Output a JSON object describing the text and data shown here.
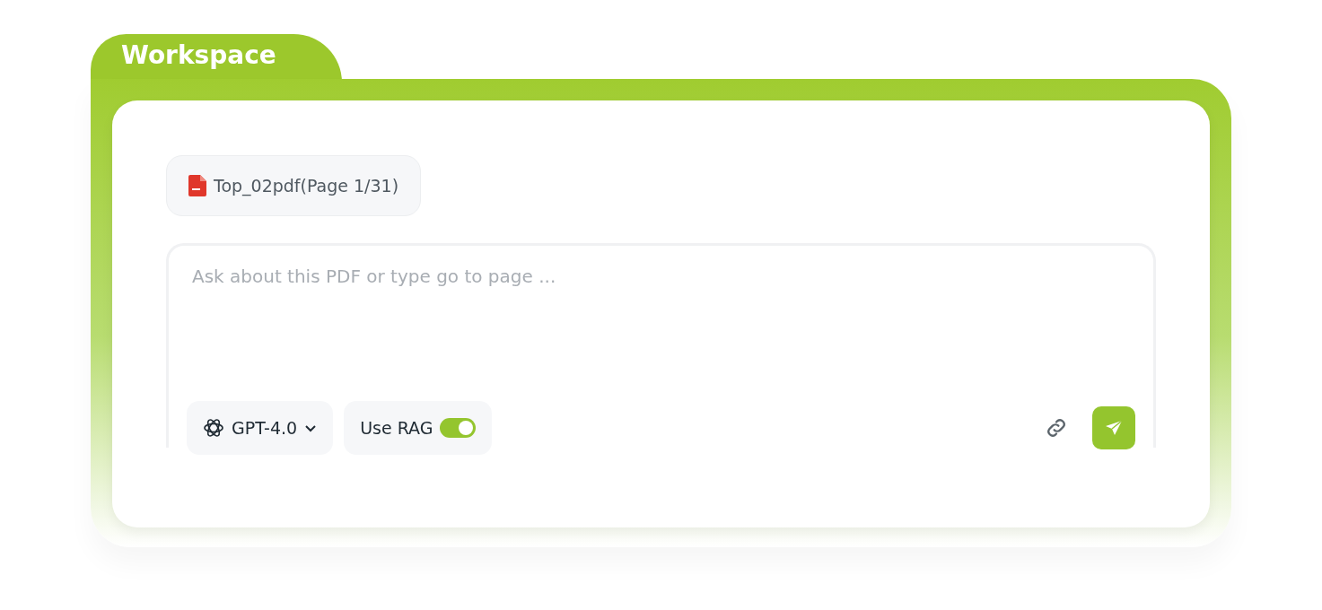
{
  "tab": {
    "title": "Workspace"
  },
  "file_chip": {
    "label": "Top_02pdf(Page 1/31)"
  },
  "prompt": {
    "placeholder": "Ask about this PDF or type go to page ..."
  },
  "model_select": {
    "label": "GPT-4.0"
  },
  "rag_toggle": {
    "label": "Use RAG",
    "on": true
  }
}
